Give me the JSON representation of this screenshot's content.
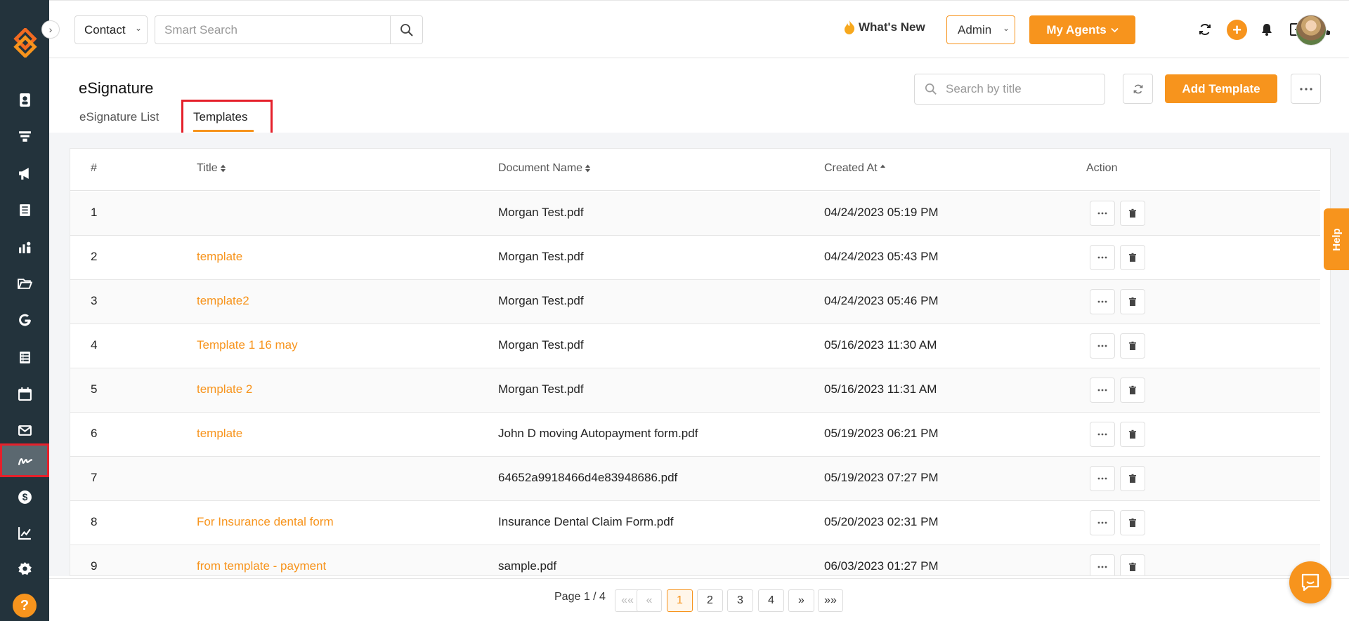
{
  "topbar": {
    "contact_select": "Contact",
    "search_placeholder": "Smart Search",
    "whats_new": "What's New",
    "admin_select": "Admin",
    "my_agents": "My Agents"
  },
  "page": {
    "title": "eSignature",
    "tabs": [
      {
        "label": "eSignature List",
        "active": false
      },
      {
        "label": "Templates",
        "active": true
      }
    ],
    "search_placeholder": "Search by title",
    "add_template": "Add Template"
  },
  "table": {
    "headers": {
      "num": "#",
      "title": "Title",
      "document_name": "Document Name",
      "created_at": "Created At",
      "action": "Action"
    },
    "rows": [
      {
        "num": "1",
        "title": "",
        "document": "Morgan Test.pdf",
        "created": "04/24/2023 05:19 PM"
      },
      {
        "num": "2",
        "title": "template",
        "document": "Morgan Test.pdf",
        "created": "04/24/2023 05:43 PM"
      },
      {
        "num": "3",
        "title": "template2",
        "document": "Morgan Test.pdf",
        "created": "04/24/2023 05:46 PM"
      },
      {
        "num": "4",
        "title": "Template 1 16 may",
        "document": "Morgan Test.pdf",
        "created": "05/16/2023 11:30 AM"
      },
      {
        "num": "5",
        "title": "template 2",
        "document": "Morgan Test.pdf",
        "created": "05/16/2023 11:31 AM"
      },
      {
        "num": "6",
        "title": "template",
        "document": "John D moving Autopayment form.pdf",
        "created": "05/19/2023 06:21 PM"
      },
      {
        "num": "7",
        "title": "",
        "document": "64652a9918466d4e83948686.pdf",
        "created": "05/19/2023 07:27 PM"
      },
      {
        "num": "8",
        "title": "For Insurance dental form",
        "document": "Insurance Dental Claim Form.pdf",
        "created": "05/20/2023 02:31 PM"
      },
      {
        "num": "9",
        "title": "from template - payment",
        "document": "sample.pdf",
        "created": "06/03/2023 01:27 PM"
      }
    ]
  },
  "pagination": {
    "info": "Page 1 / 4",
    "first": "««",
    "prev": "«",
    "pages": [
      "1",
      "2",
      "3",
      "4"
    ],
    "current": "1",
    "next": "»",
    "last": "»»"
  },
  "help_tab": "Help",
  "colors": {
    "accent": "#f7941d",
    "sidebar": "#23333c",
    "highlight": "#e5202b"
  },
  "sidebar_icons": [
    "contacts-icon",
    "funnel-icon",
    "megaphone-icon",
    "document-icon",
    "people-chart-icon",
    "folder-open-icon",
    "google-icon",
    "list-icon",
    "calendar-icon",
    "mail-icon",
    "signature-icon",
    "dollar-icon",
    "line-chart-icon",
    "gear-icon"
  ]
}
